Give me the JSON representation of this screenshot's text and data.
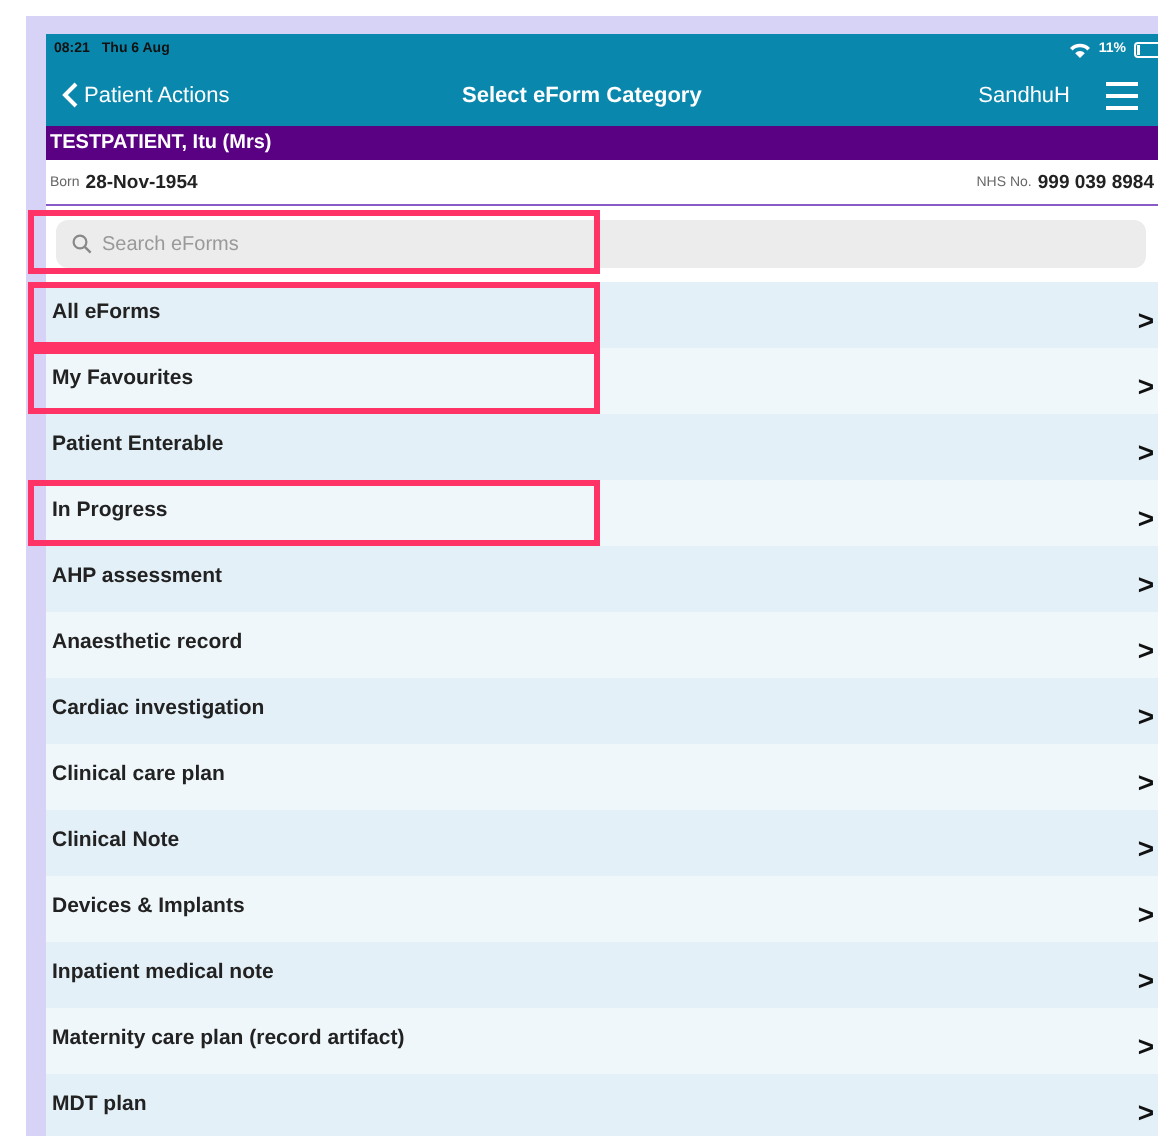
{
  "status_bar": {
    "time": "08:21",
    "date": "Thu 6 Aug",
    "battery": "11%"
  },
  "nav_bar": {
    "back": "Patient Actions",
    "title": "Select eForm Category",
    "user": "SandhuH"
  },
  "patient": {
    "name": "TESTPATIENT, Itu (Mrs)",
    "born_label": "Born",
    "born": "28-Nov-1954",
    "nhs_label": "NHS No.",
    "nhs": "999 039 8984"
  },
  "search": {
    "placeholder": "Search eForms",
    "highlighted": true
  },
  "categories": [
    {
      "label": "All eForms",
      "chevron": ">",
      "highlighted": true
    },
    {
      "label": "My Favourites",
      "chevron": ">",
      "highlighted": true
    },
    {
      "label": "Patient Enterable",
      "chevron": ">",
      "highlighted": false
    },
    {
      "label": "In Progress",
      "chevron": ">",
      "highlighted": true
    },
    {
      "label": "AHP assessment",
      "chevron": ">",
      "highlighted": false
    },
    {
      "label": "Anaesthetic record",
      "chevron": ">",
      "highlighted": false
    },
    {
      "label": "Cardiac investigation",
      "chevron": ">",
      "highlighted": false
    },
    {
      "label": "Clinical care plan",
      "chevron": ">",
      "highlighted": false
    },
    {
      "label": "Clinical Note",
      "chevron": ">",
      "highlighted": false
    },
    {
      "label": "Devices & Implants",
      "chevron": ">",
      "highlighted": false
    },
    {
      "label": "Inpatient medical note",
      "chevron": ">",
      "highlighted": false
    },
    {
      "label": "Maternity care plan (record artifact)",
      "chevron": ">",
      "highlighted": false
    },
    {
      "label": "MDT plan",
      "chevron": ">",
      "highlighted": false
    }
  ]
}
